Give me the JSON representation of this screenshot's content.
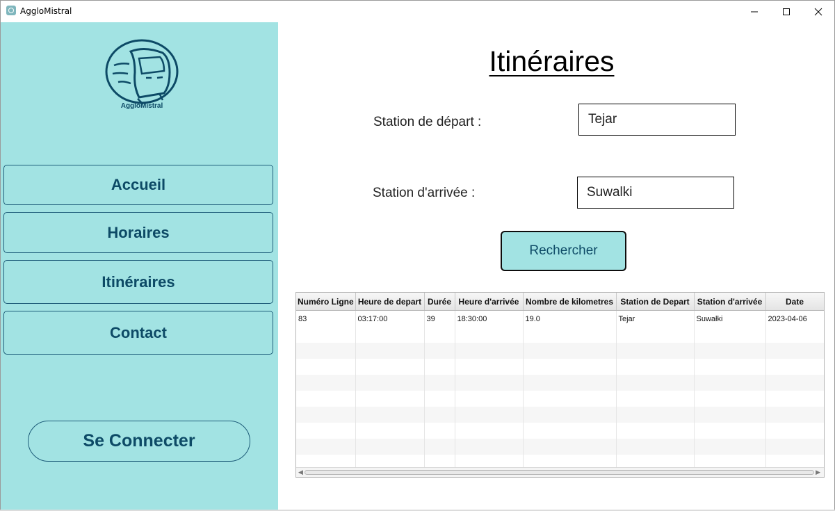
{
  "window": {
    "title": "AggloMistral"
  },
  "sidebar": {
    "logo_text": "AggloMistral",
    "nav": [
      {
        "label": "Accueil"
      },
      {
        "label": "Horaires"
      },
      {
        "label": "Itinéraires"
      },
      {
        "label": "Contact"
      }
    ],
    "connect_label": "Se Connecter"
  },
  "main": {
    "title": "Itinéraires",
    "departure": {
      "label": "Station de départ :",
      "value": "Tejar"
    },
    "arrival": {
      "label": "Station d'arrivée :",
      "value": "Suwalki"
    },
    "search_label": "Rechercher",
    "table": {
      "headers": [
        "Numéro Ligne",
        "Heure de depart",
        "Durée",
        "Heure d'arrivée",
        "Nombre de kilometres",
        "Station de Depart",
        "Station d'arrivée",
        "Date"
      ],
      "rows": [
        [
          "83",
          "03:17:00",
          "39",
          "18:30:00",
          "19.0",
          "Tejar",
          "Suwałki",
          "2023-04-06"
        ]
      ]
    }
  },
  "colors": {
    "sidebar_bg": "#a2e3e3",
    "accent_text": "#0d4a66",
    "border": "#1c5b78"
  }
}
